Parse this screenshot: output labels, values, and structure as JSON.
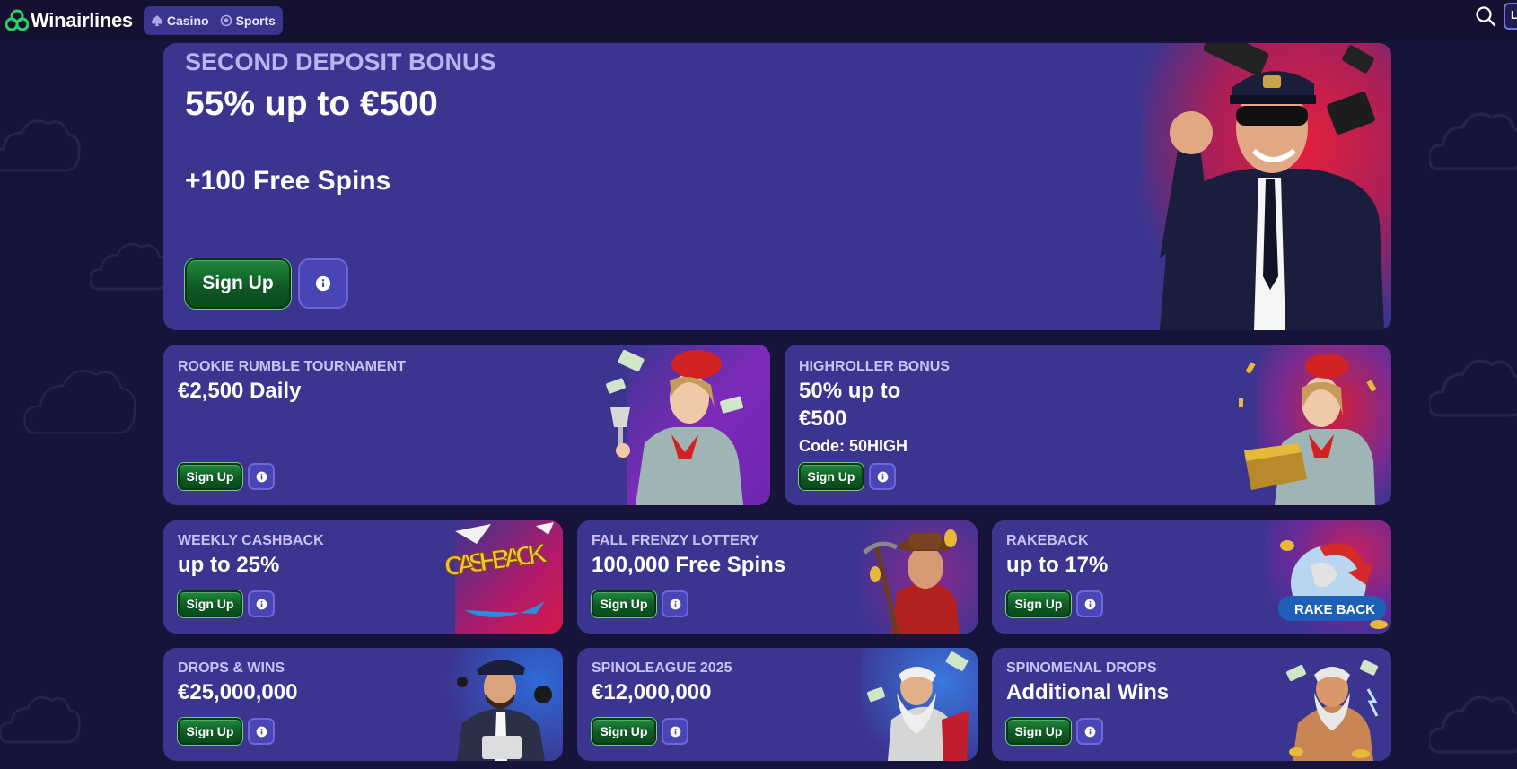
{
  "brand": {
    "name": "Winairlines"
  },
  "nav": [
    {
      "label": "Casino",
      "icon": "spade-icon"
    },
    {
      "label": "Sports",
      "icon": "ball-icon"
    }
  ],
  "header": {
    "search_icon": "search-icon",
    "login_partial": "L"
  },
  "hero": {
    "kicker": "SECOND DEPOSIT BONUS",
    "headline": "55% up to €500",
    "sub": "+100 Free Spins",
    "signup_label": "Sign Up",
    "info_icon": "info-icon"
  },
  "promos_mid": [
    {
      "kicker": "ROOKIE RUMBLE TOURNAMENT",
      "headline": "€2,500 Daily",
      "code": "",
      "signup_label": "Sign Up"
    },
    {
      "kicker": "HIGHROLLER BONUS",
      "headline": "50% up to €500",
      "code": "Code: 50HIGH",
      "signup_label": "Sign Up"
    }
  ],
  "promos_small": [
    {
      "kicker": "WEEKLY CASHBACK",
      "headline": "up to 25%",
      "signup_label": "Sign Up",
      "art_text": "CASH BACK"
    },
    {
      "kicker": "FALL FRENZY LOTTERY",
      "headline": "100,000 Free Spins",
      "signup_label": "Sign Up"
    },
    {
      "kicker": "RAKEBACK",
      "headline": "up to 17%",
      "signup_label": "Sign Up",
      "art_text": "RAKE BACK"
    },
    {
      "kicker": "DROPS & WINS",
      "headline": "€25,000,000",
      "signup_label": "Sign Up"
    },
    {
      "kicker": "SPINOLEAGUE 2025",
      "headline": "€12,000,000",
      "signup_label": "Sign Up"
    },
    {
      "kicker": "SPINOMENAL DROPS",
      "headline": "Additional Wins",
      "signup_label": "Sign Up"
    }
  ],
  "colors": {
    "page_bg": "#16143a",
    "card_bg": "#3b3590",
    "signup_green": "#0f5a25",
    "accent_red": "#d11f3a"
  }
}
